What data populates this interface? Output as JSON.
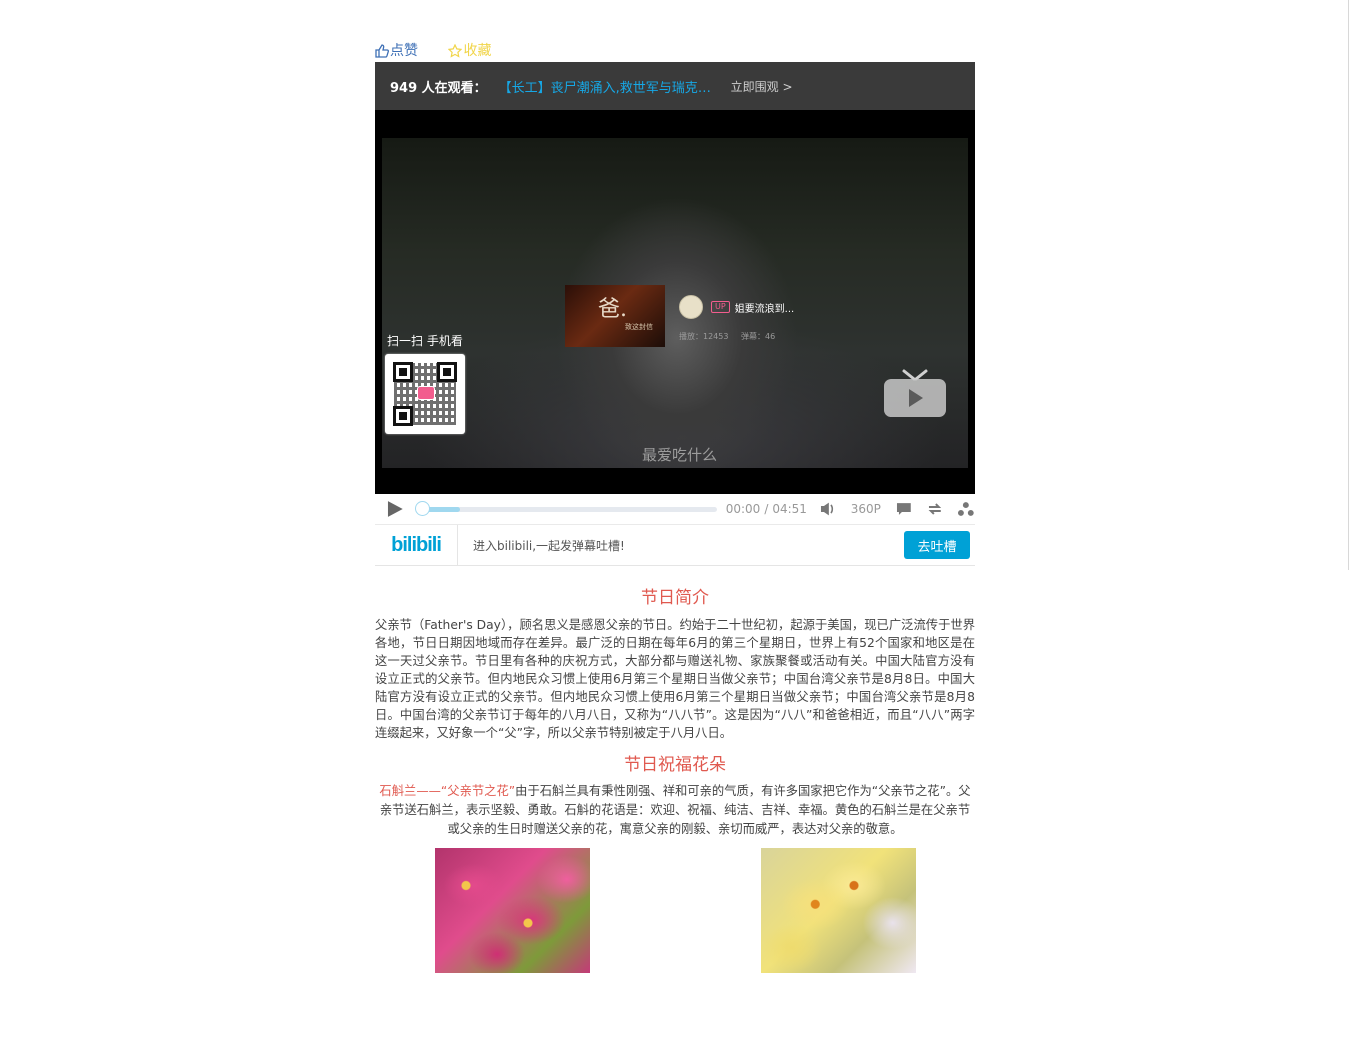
{
  "actions": {
    "like_label": "点赞",
    "fav_label": "收藏"
  },
  "player": {
    "watching_count": "949 人在观看：",
    "live_title": "【长工】丧尸潮涌入,救世军与瑞克团体大战",
    "watch_now": "立即围观 >",
    "subtitle": "最爱吃什么",
    "recommend": {
      "thumb_text": "爸.",
      "thumb_small_text": "致这封信",
      "up_badge": "UP",
      "up_name": "姐要流浪到...",
      "plays": "播放：12453",
      "danmaku": "弹幕：46"
    },
    "scan_label": "扫一扫 手机看",
    "time_current": "00:00",
    "time_sep": "/",
    "time_total": "04:51",
    "progress": 0.0,
    "buffered": 0.13,
    "quality": "360P"
  },
  "danmaku_bar": {
    "logo": "bilibili",
    "hint": "进入bilibili,一起发弹幕吐槽!",
    "button": "去吐槽"
  },
  "article": {
    "heading1": "节日简介",
    "intro": "父亲节（Father's Day），顾名思义是感恩父亲的节日。约始于二十世纪初，起源于美国，现已广泛流传于世界各地，节日日期因地域而存在差异。最广泛的日期在每年6月的第三个星期日，世界上有52个国家和地区是在这一天过父亲节。节日里有各种的庆祝方式，大部分都与赠送礼物、家族聚餐或活动有关。中国大陆官方没有设立正式的父亲节。但内地民众习惯上使用6月第三个星期日当做父亲节；中国台湾父亲节是8月8日。中国大陆官方没有设立正式的父亲节。但内地民众习惯上使用6月第三个星期日当做父亲节；中国台湾父亲节是8月8日。中国台湾的父亲节订于每年的八月八日，又称为“八八节”。这是因为“八八”和爸爸相近，而且“八八”两字连缀起来，又好象一个“父”字，所以父亲节特别被定于八月八日。",
    "heading2": "节日祝福花朵",
    "flower_highlight": "石斛兰——“父亲节之花”",
    "flower_text": "由于石斛兰具有秉性刚强、祥和可亲的气质，有许多国家把它作为“父亲节之花”。父亲节送石斛兰，表示坚毅、勇敢。石斛的花语是：欢迎、祝福、纯洁、吉祥、幸福。黄色的石斛兰是在父亲节或父亲的生日时赠送父亲的花，寓意父亲的刚毅、亲切而威严，表达对父亲的敬意。"
  },
  "colors": {
    "accent_blue": "#00a1d6",
    "heading_red": "#e0594f",
    "live_blue": "#16a8e6"
  }
}
